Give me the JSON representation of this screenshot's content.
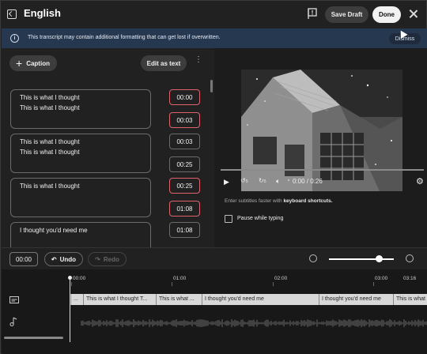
{
  "header": {
    "title": "English",
    "save_draft": "Save Draft",
    "done": "Done"
  },
  "banner": {
    "message": "This transcript may contain additional formatting that can get lost if overwritten.",
    "dismiss": "Dismiss"
  },
  "editor": {
    "caption_button": "Caption",
    "edit_as_text": "Edit as text",
    "cues": [
      {
        "lines": [
          "This is what I thought",
          "This is what I thought"
        ],
        "start": "00:00",
        "end": "00:03"
      },
      {
        "lines": [
          "This is what I thought",
          "This is what I thought"
        ],
        "start": "00:03",
        "end": "00:25"
      },
      {
        "lines": [
          "This is what I thought"
        ],
        "start": "00:25",
        "end": "01:08"
      },
      {
        "lines": [
          "I thought you'd need me"
        ],
        "start": "01:08"
      }
    ]
  },
  "player": {
    "time": "0:00 / 0:26",
    "hint_prefix": "Enter subtitles faster with",
    "hint_link": "keyboard shortcuts.",
    "pause_label": "Pause while typing",
    "rewind_seconds": "5",
    "forward_seconds": "5"
  },
  "toolbar": {
    "current_time": "00:00",
    "undo": "Undo",
    "redo": "Redo"
  },
  "timeline": {
    "ruler": [
      "00:00",
      "01:00",
      "02:00",
      "03:00",
      "03:16"
    ],
    "segments": [
      "...",
      "This is what I thought  T...",
      "This is what ...",
      "I thought you'd need me",
      "I thought you'd need me",
      "This is what ..."
    ]
  },
  "colors": {
    "banner_bg": "#263850",
    "time_highlight": "#e0636b"
  }
}
